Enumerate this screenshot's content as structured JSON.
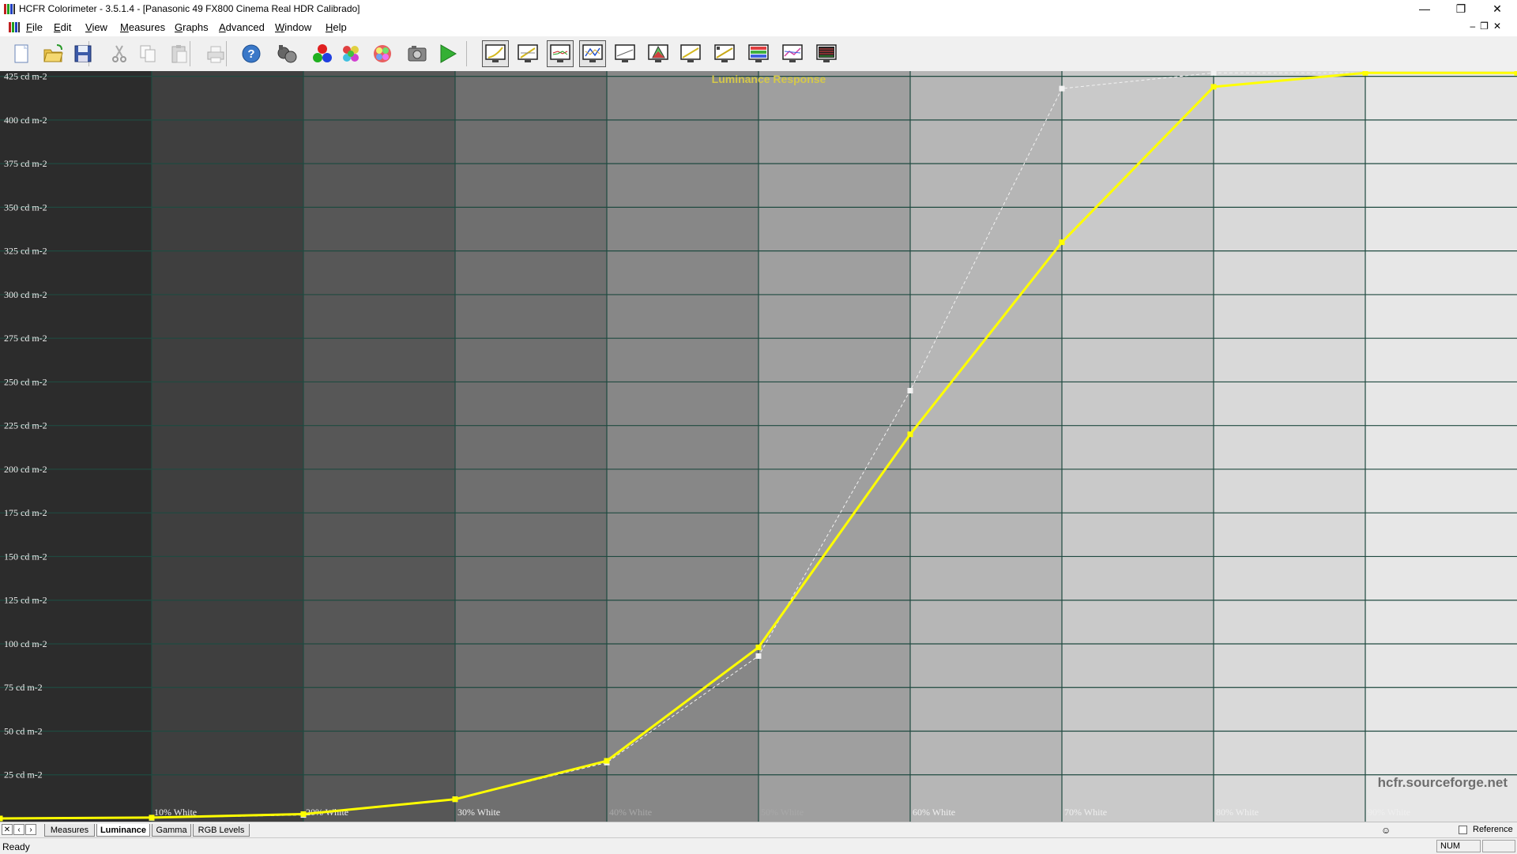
{
  "window": {
    "title": "HCFR Colorimeter - 3.5.1.4 - [Panasonic 49 FX800 Cinema Real HDR Calibrado]",
    "controls": {
      "minimize": "—",
      "restore": "❐",
      "close": "✕"
    },
    "mdi_controls": {
      "minimize": "–",
      "restore": "❐",
      "close": "✕"
    }
  },
  "menu": [
    {
      "u": "F",
      "rest": "ile"
    },
    {
      "u": "E",
      "rest": "dit"
    },
    {
      "u": "V",
      "rest": "iew"
    },
    {
      "u": "M",
      "rest": "easures"
    },
    {
      "u": "G",
      "rest": "raphs"
    },
    {
      "u": "A",
      "rest": "dvanced"
    },
    {
      "u": "W",
      "rest": "indow"
    },
    {
      "u": "H",
      "rest": "elp"
    }
  ],
  "toolbar": {
    "buttons": [
      "new-icon",
      "open-icon",
      "save-icon",
      "cut-icon",
      "copy-icon",
      "paste-icon",
      "print-icon",
      "help-icon",
      "sensor-icon",
      "rgb-icon",
      "colors-icon",
      "saturation-icon",
      "camera-icon",
      "play-icon",
      "view-luminance-icon",
      "view-gamma-icon",
      "view-rgb-icon",
      "view-cie-icon",
      "view-color-temp-icon",
      "view-cie-diagram-icon",
      "view-saturation-icon",
      "view-near-black-icon",
      "view-near-white-icon",
      "view-color-comparator-icon",
      "view-measures-icon"
    ],
    "pressed": [
      14,
      16,
      17
    ]
  },
  "chart_data": {
    "type": "line",
    "title": "Luminance Response",
    "watermark": "hcfr.sourceforge.net",
    "x": [
      0,
      10,
      20,
      30,
      40,
      50,
      60,
      70,
      80,
      90,
      100
    ],
    "tick_labels": [
      "10% White",
      "20% White",
      "30% White",
      "40% White",
      "50% White",
      "60% White",
      "70% White",
      "80% White",
      "90% White"
    ],
    "y_ticks": [
      25,
      50,
      75,
      100,
      125,
      150,
      175,
      200,
      225,
      250,
      275,
      300,
      325,
      350,
      375,
      400,
      425
    ],
    "y_tick_labels": [
      "25 cd m-2",
      "50 cd m-2",
      "75 cd m-2",
      "100 cd m-2",
      "125 cd m-2",
      "150 cd m-2",
      "175 cd m-2",
      "200 cd m-2",
      "225 cd m-2",
      "250 cd m-2",
      "275 cd m-2",
      "300 cd m-2",
      "325 cd m-2",
      "350 cd m-2",
      "375 cd m-2",
      "400 cd m-2",
      "425 cd m-2"
    ],
    "ylim": [
      0,
      428
    ],
    "xlim": [
      0,
      100
    ],
    "series": [
      {
        "values": [
          0,
          0.5,
          2.5,
          11,
          33,
          98,
          220,
          330,
          419,
          427,
          427
        ],
        "color": "#ffff00",
        "style": "solid"
      },
      {
        "values": [
          0,
          0.3,
          2,
          11,
          32,
          93,
          245,
          418,
          427,
          427,
          427
        ],
        "color": "#f2f2f2",
        "style": "dashed"
      }
    ]
  },
  "tabs": {
    "nav": [
      "✕",
      "‹",
      "›"
    ],
    "items": [
      "Measures",
      "Luminance",
      "Gamma",
      "RGB Levels"
    ],
    "active": 1
  },
  "reference_label": "Reference",
  "status": {
    "text": "Ready",
    "num": "NUM"
  }
}
